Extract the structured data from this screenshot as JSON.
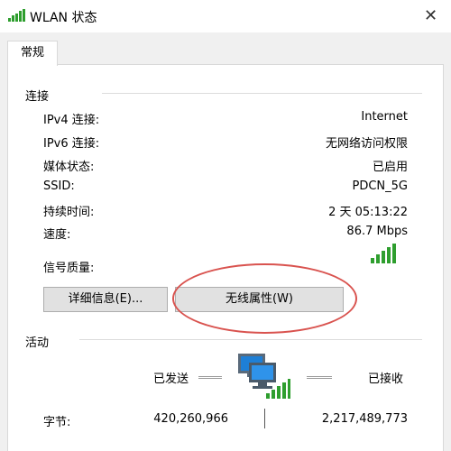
{
  "window": {
    "title": "WLAN 状态",
    "close_glyph": "✕"
  },
  "tabs": [
    {
      "label": "常规"
    }
  ],
  "connection": {
    "section_title": "连接",
    "rows": [
      {
        "label": "IPv4 连接:",
        "value": "Internet"
      },
      {
        "label": "IPv6 连接:",
        "value": "无网络访问权限"
      },
      {
        "label": "媒体状态:",
        "value": "已启用"
      },
      {
        "label": "SSID:",
        "value": "PDCN_5G"
      },
      {
        "label": "持续时间:",
        "value": "2 天 05:13:22"
      },
      {
        "label": "速度:",
        "value": "86.7 Mbps"
      },
      {
        "label": "信号质量:",
        "value": ""
      }
    ],
    "signal_bars": 5,
    "buttons": {
      "details": "详细信息(E)...",
      "wireless_properties": "无线属性(W)"
    }
  },
  "activity": {
    "section_title": "活动",
    "sent_label": "已发送",
    "received_label": "已接收",
    "bytes_label": "字节:",
    "bytes_sent": "420,260,966",
    "bytes_received": "2,217,489,773"
  },
  "colors": {
    "signal": "#2e9e2e",
    "annotation": "#d9534f",
    "monitor": "#1e7fd6"
  },
  "icons": [
    "wifi-signal-icon",
    "close-icon",
    "signal-quality-icon",
    "network-computers-icon"
  ]
}
